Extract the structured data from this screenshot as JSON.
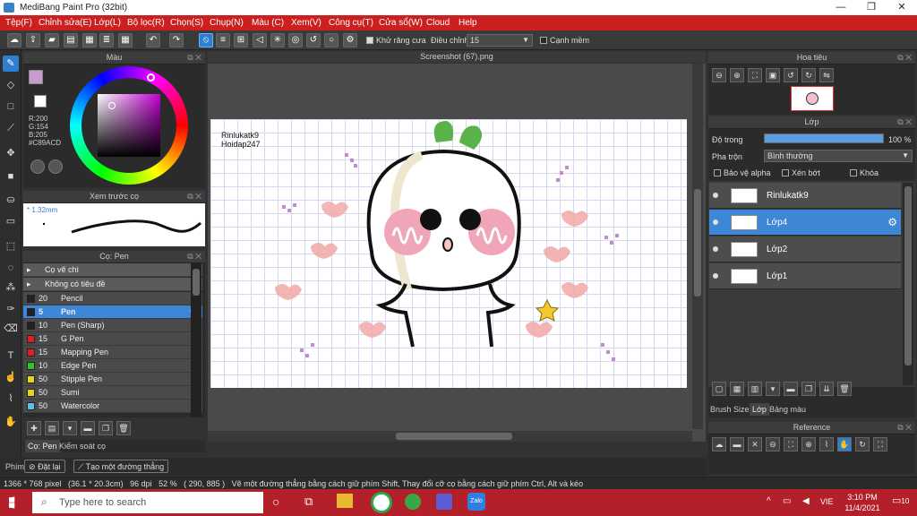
{
  "window": {
    "title": "MediBang Paint Pro (32bit)",
    "minimize": "—",
    "maximize": "❐",
    "close": "✕"
  },
  "menu": [
    "Tệp(F)",
    "Chỉnh sửa(E)",
    "Lớp(L)",
    "Bộ lọc(R)",
    "Chọn(S)",
    "Chụp(N)",
    "Màu (C)",
    "Xem(V)",
    "Công cụ(T)",
    "Cửa sổ(W)",
    "Cloud",
    "Help"
  ],
  "toolbar": {
    "antialias_label": "Khử răng cưa",
    "correction_label": "Điều chỉnh",
    "correction_value": "15",
    "edge_label": "Cạnh mềm"
  },
  "color_panel": {
    "title": "Màu",
    "r": "R:200",
    "g": "G:154",
    "b": "B:205",
    "hex": "#C89ACD",
    "primary_color": "#C89ACD",
    "secondary_color": "#ffffff"
  },
  "brush_preview": {
    "title": "Xem trước cọ",
    "size": "1.32mm"
  },
  "brush_panel": {
    "title": "Cọ: Pen",
    "group1": "Cọ vẽ chì",
    "group2": "Không có tiêu đề",
    "items": [
      {
        "size": "20",
        "name": "Pencil",
        "color": "#222222"
      },
      {
        "size": "5",
        "name": "Pen",
        "color": "#222222",
        "selected": true
      },
      {
        "size": "10",
        "name": "Pen (Sharp)",
        "color": "#222222"
      },
      {
        "size": "15",
        "name": "G Pen",
        "color": "#e02020"
      },
      {
        "size": "15",
        "name": "Mapping Pen",
        "color": "#e02020"
      },
      {
        "size": "10",
        "name": "Edge Pen",
        "color": "#30c030"
      },
      {
        "size": "50",
        "name": "Stipple Pen",
        "color": "#e8d020"
      },
      {
        "size": "50",
        "name": "Sumi",
        "color": "#e8d020"
      },
      {
        "size": "50",
        "name": "Watercolor",
        "color": "#60c0e8"
      }
    ],
    "tab1": "Cọ: Pen",
    "tab2": "Kiểm soát cọ"
  },
  "canvas": {
    "tab": "Screenshot (67).png",
    "text1": "Rinlukatk9",
    "text2": "Hoidap247"
  },
  "navigator": {
    "title": "Hoa tiêu"
  },
  "layers_panel": {
    "title": "Lớp",
    "opacity_label": "Độ trong",
    "opacity_value": "100 %",
    "opacity_fraction": 1.0,
    "blend_label": "Pha trộn",
    "blend_value": "Bình thường",
    "protect_alpha": "Bảo vệ alpha",
    "clipping": "Xén bớt",
    "lock": "Khóa",
    "layers": [
      {
        "name": "Rinlukatk9",
        "selected": false
      },
      {
        "name": "Lớp4",
        "selected": true
      },
      {
        "name": "Lớp2",
        "selected": false
      },
      {
        "name": "Lớp1",
        "selected": false
      }
    ],
    "tabs": [
      "Brush Size",
      "Lớp",
      "Bảng màu"
    ]
  },
  "reference": {
    "title": "Reference"
  },
  "bottom": {
    "keys_label": "Phím",
    "reset_label": "Đặt lại",
    "line_label": "Tạo một đường thẳng"
  },
  "status": {
    "text": "1366 * 768 pixel   (36.1 * 20.3cm)   96 dpi   52 %   ( 290, 885 )   Vẽ một đường thẳng bằng cách giữ phím Shift, Thay đổi cỡ cọ bằng cách giữ phím Ctrl, Alt và kéo"
  },
  "taskbar": {
    "search_placeholder": "Type here to search",
    "lang": "VIE",
    "time": "3:10 PM",
    "date": "11/4/2021",
    "notif": "10"
  }
}
